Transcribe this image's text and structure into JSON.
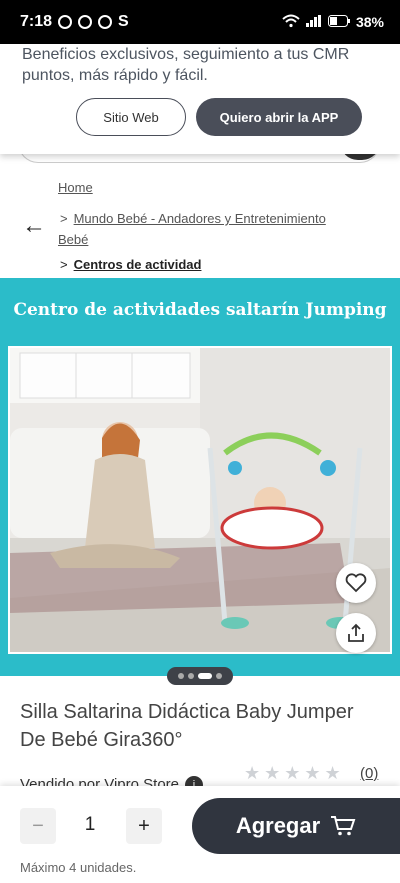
{
  "status_bar": {
    "time": "7:18",
    "carrier_letter": "S",
    "battery": "38%"
  },
  "banner": {
    "text": "Beneficios exclusivos, seguimiento a tus CMR puntos, más rápido y fácil.",
    "web_button": "Sitio Web",
    "app_button": "Quiero abrir la APP"
  },
  "breadcrumbs": {
    "home": "Home",
    "category": "Mundo Bebé - Andadores y Entretenimiento Bebé",
    "current": "Centros de actividad",
    "separator": ">"
  },
  "hero": {
    "title": "Centro de actividades saltarín Jumping",
    "background_color": "#2bbcc9"
  },
  "carousel": {
    "total": 4,
    "active_index": 2
  },
  "product": {
    "title": "Silla Saltarina Didáctica Baby Jumper De Bebé Gira360°",
    "seller": "Vendido por Vipro Store",
    "rating_count": "(0)"
  },
  "purchase": {
    "minus": "−",
    "plus": "+",
    "quantity": "1",
    "add_label": "Agregar",
    "max_units": "Máximo 4 unidades."
  },
  "colors": {
    "primary_dark": "#30353f",
    "accent": "#2bbcc9"
  }
}
